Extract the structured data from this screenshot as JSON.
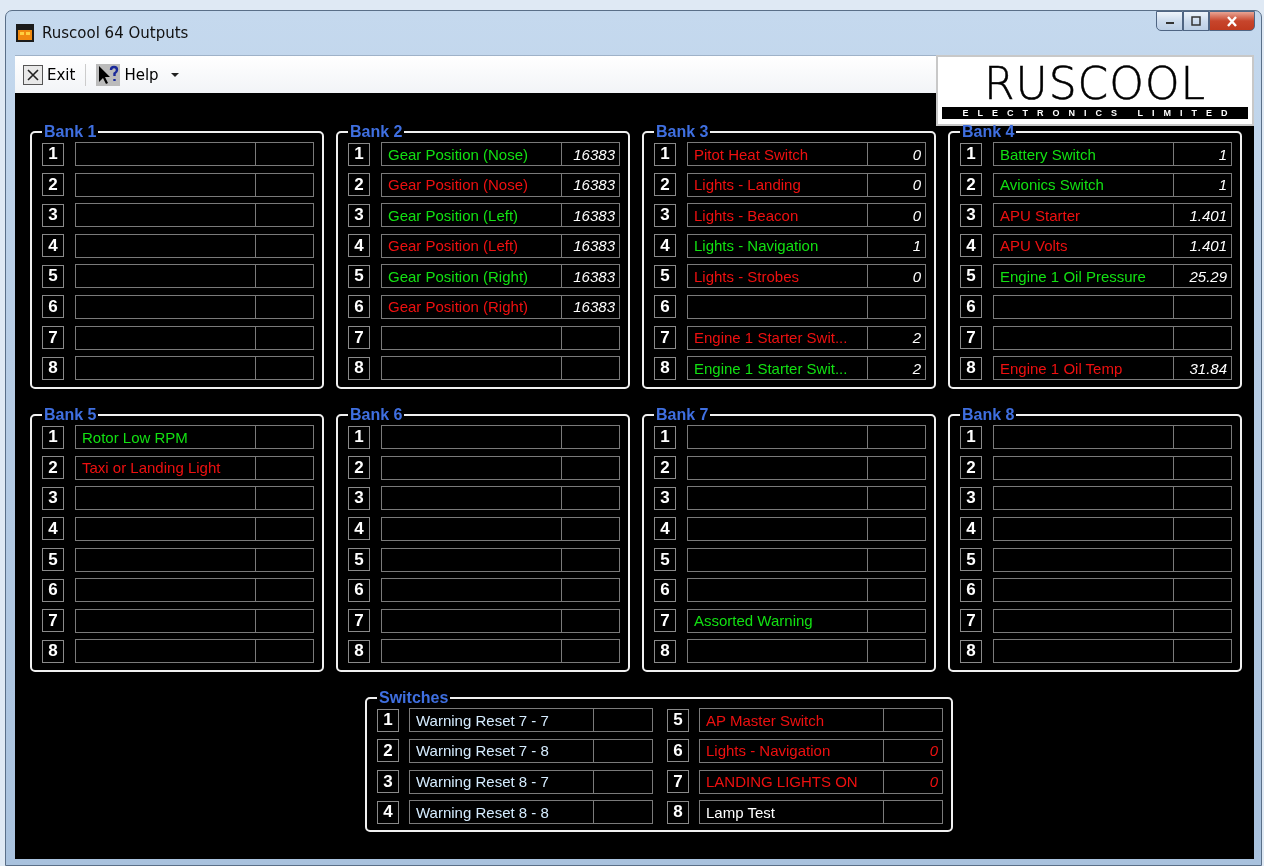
{
  "window": {
    "title": "Ruscool 64 Outputs"
  },
  "menu": [
    {
      "label": "Exit",
      "kind": "exit"
    },
    {
      "label": "Help",
      "kind": "help"
    }
  ],
  "logo": {
    "name": "RUSCOOL",
    "tagline": "ELECTRONICS LIMITED"
  },
  "banks": [
    {
      "title": "Bank 1",
      "rows": [
        {
          "number": "1"
        },
        {
          "number": "2"
        },
        {
          "number": "3"
        },
        {
          "number": "4"
        },
        {
          "number": "5"
        },
        {
          "number": "6"
        },
        {
          "number": "7"
        },
        {
          "number": "8"
        }
      ]
    },
    {
      "title": "Bank 2",
      "rows": [
        {
          "number": "1",
          "label": "Gear Position (Nose)",
          "value": "16383",
          "color": "#12e012"
        },
        {
          "number": "2",
          "label": "Gear Position (Nose)",
          "value": "16383",
          "color": "#ee1010"
        },
        {
          "number": "3",
          "label": "Gear Position (Left)",
          "value": "16383",
          "color": "#12e012"
        },
        {
          "number": "4",
          "label": "Gear Position (Left)",
          "value": "16383",
          "color": "#ee1010"
        },
        {
          "number": "5",
          "label": "Gear Position (Right)",
          "value": "16383",
          "color": "#12e012"
        },
        {
          "number": "6",
          "label": "Gear Position (Right)",
          "value": "16383",
          "color": "#ee1010"
        },
        {
          "number": "7"
        },
        {
          "number": "8"
        }
      ]
    },
    {
      "title": "Bank 3",
      "rows": [
        {
          "number": "1",
          "label": "Pitot Heat Switch",
          "value": "0",
          "color": "#ee1010"
        },
        {
          "number": "2",
          "label": "Lights - Landing",
          "value": "0",
          "color": "#ee1010"
        },
        {
          "number": "3",
          "label": "Lights - Beacon",
          "value": "0",
          "color": "#ee1010"
        },
        {
          "number": "4",
          "label": "Lights - Navigation",
          "value": "1",
          "color": "#12e012"
        },
        {
          "number": "5",
          "label": "Lights - Strobes",
          "value": "0",
          "color": "#ee1010"
        },
        {
          "number": "6"
        },
        {
          "number": "7",
          "label": "Engine 1 Starter Swit...",
          "value": "2",
          "color": "#ee1010"
        },
        {
          "number": "8",
          "label": "Engine 1 Starter Swit...",
          "value": "2",
          "color": "#12e012"
        }
      ]
    },
    {
      "title": "Bank 4",
      "rows": [
        {
          "number": "1",
          "label": "Battery Switch",
          "value": "1",
          "color": "#12e012"
        },
        {
          "number": "2",
          "label": "Avionics Switch",
          "value": "1",
          "color": "#12e012"
        },
        {
          "number": "3",
          "label": "APU Starter",
          "value": "1.401",
          "color": "#ee1010"
        },
        {
          "number": "4",
          "label": "APU Volts",
          "value": "1.401",
          "color": "#ee1010"
        },
        {
          "number": "5",
          "label": "Engine 1 Oil Pressure",
          "value": "25.29",
          "color": "#12e012"
        },
        {
          "number": "6"
        },
        {
          "number": "7"
        },
        {
          "number": "8",
          "label": "Engine 1 Oil Temp",
          "value": "31.84",
          "color": "#ee1010"
        }
      ]
    },
    {
      "title": "Bank 5",
      "rows": [
        {
          "number": "1",
          "label": "Rotor Low RPM",
          "color": "#12e012"
        },
        {
          "number": "2",
          "label": "Taxi or Landing Light",
          "color": "#ee1010"
        },
        {
          "number": "3"
        },
        {
          "number": "4"
        },
        {
          "number": "5"
        },
        {
          "number": "6"
        },
        {
          "number": "7"
        },
        {
          "number": "8"
        }
      ]
    },
    {
      "title": "Bank 6",
      "rows": [
        {
          "number": "1"
        },
        {
          "number": "2"
        },
        {
          "number": "3"
        },
        {
          "number": "4"
        },
        {
          "number": "5"
        },
        {
          "number": "6"
        },
        {
          "number": "7"
        },
        {
          "number": "8"
        }
      ]
    },
    {
      "title": "Bank 7",
      "rows": [
        {
          "number": "1"
        },
        {
          "number": "2"
        },
        {
          "number": "3"
        },
        {
          "number": "4"
        },
        {
          "number": "5"
        },
        {
          "number": "6"
        },
        {
          "number": "7",
          "label": "Assorted Warning",
          "color": "#12e012"
        },
        {
          "number": "8"
        }
      ]
    },
    {
      "title": "Bank 8",
      "rows": [
        {
          "number": "1"
        },
        {
          "number": "2"
        },
        {
          "number": "3"
        },
        {
          "number": "4"
        },
        {
          "number": "5"
        },
        {
          "number": "6"
        },
        {
          "number": "7"
        },
        {
          "number": "8"
        }
      ]
    }
  ],
  "switches": {
    "title": "Switches",
    "rows": [
      {
        "number": "1",
        "label": "Warning Reset 7 - 7",
        "color": "#d5ecff"
      },
      {
        "number": "2",
        "label": "Warning Reset 7 - 8",
        "color": "#d5ecff"
      },
      {
        "number": "3",
        "label": "Warning Reset 8 - 7",
        "color": "#d5ecff"
      },
      {
        "number": "4",
        "label": "Warning Reset 8 - 8",
        "color": "#d5ecff"
      },
      {
        "number": "5",
        "label": "AP Master Switch",
        "color": "#ee1010"
      },
      {
        "number": "6",
        "label": "Lights - Navigation",
        "value": "0",
        "color": "#ee1010"
      },
      {
        "number": "7",
        "label": "LANDING LIGHTS ON",
        "value": "0",
        "color": "#ee1010"
      },
      {
        "number": "8",
        "label": "Lamp Test",
        "color": "#ffffff"
      }
    ]
  }
}
